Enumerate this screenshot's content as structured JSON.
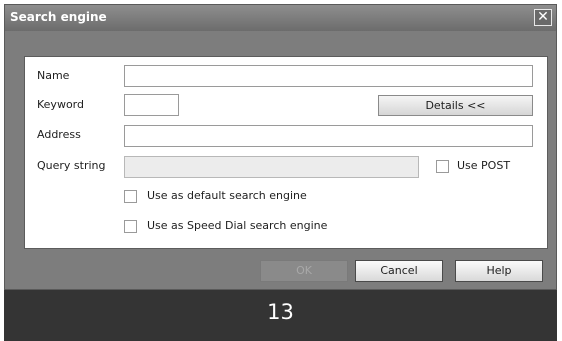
{
  "dialog": {
    "title": "Search engine",
    "close_glyph": "✕",
    "close_icon": "close-icon"
  },
  "form": {
    "name_label": "Name",
    "name_value": "",
    "keyword_label": "Keyword",
    "keyword_value": "",
    "details_button": "Details <<",
    "address_label": "Address",
    "address_value": "",
    "query_label": "Query string",
    "query_value": "",
    "use_post_label": "Use POST",
    "use_post_checked": false,
    "default_label": "Use as default search engine",
    "default_checked": false,
    "speeddial_label": "Use as Speed Dial search engine",
    "speeddial_checked": false
  },
  "buttons": {
    "ok": "OK",
    "cancel": "Cancel",
    "help": "Help"
  },
  "footer": {
    "page_number": "13"
  }
}
